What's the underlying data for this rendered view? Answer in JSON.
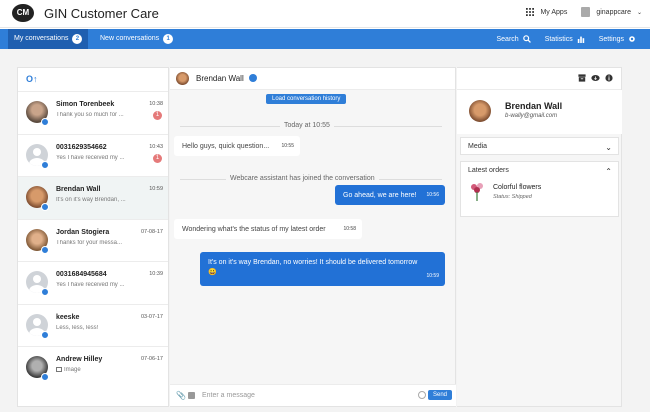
{
  "header": {
    "logo": "CM",
    "title": "GIN Customer Care",
    "my_apps": "My Apps",
    "user": "ginappcare"
  },
  "nav": {
    "tabs": [
      {
        "label": "My conversations",
        "count": "2"
      },
      {
        "label": "New conversations",
        "count": "1"
      }
    ],
    "search": "Search",
    "statistics": "Statistics",
    "settings": "Settings"
  },
  "conversations": [
    {
      "name": "Simon Torenbeek",
      "preview": "Thank you so much for ...",
      "time": "10:38",
      "unread": "1"
    },
    {
      "name": "0031629354662",
      "preview": "Yes I have received my ...",
      "time": "10:43",
      "unread": "1"
    },
    {
      "name": "Brendan Wall",
      "preview": "It's on it's way Brendan, ...",
      "time": "10:59"
    },
    {
      "name": "Jordan Stogiera",
      "preview": "Thanks for your messa...",
      "time": "07-08-17"
    },
    {
      "name": "0031684945684",
      "preview": "Yes I have received my ...",
      "time": "10:39"
    },
    {
      "name": "keeske",
      "preview": "Less, less, less!",
      "time": "03-07-17"
    },
    {
      "name": "Andrew Hilley",
      "preview": "Image",
      "time": "07-06-17"
    }
  ],
  "chat": {
    "name": "Brendan Wall",
    "history_button": "Load conversation history",
    "date_divider": "Today at 10:55",
    "event": "Webcare assistant has joined the conversation",
    "messages": [
      {
        "dir": "in",
        "text": "Hello guys, quick question...",
        "time": "10:55"
      },
      {
        "dir": "out",
        "text": "Go ahead, we are here!",
        "time": "10:56"
      },
      {
        "dir": "in",
        "text": "Wondering what's the status of my latest order",
        "time": "10:58"
      },
      {
        "dir": "out",
        "text": "It's on it's way Brendan, no worries! It should be delivered tomorrow 😀",
        "time": "10:59"
      }
    ],
    "input_placeholder": "Enter a message",
    "send": "Send"
  },
  "profile": {
    "name": "Brendan Wall",
    "email": "b-wally@gmail.com",
    "media_label": "Media",
    "orders_label": "Latest orders",
    "order_name": "Colorful flowers",
    "order_status": "Status: Shipped"
  },
  "colors": {
    "brand_blue": "#2f7ed8",
    "unread_red": "#e57a7a"
  }
}
